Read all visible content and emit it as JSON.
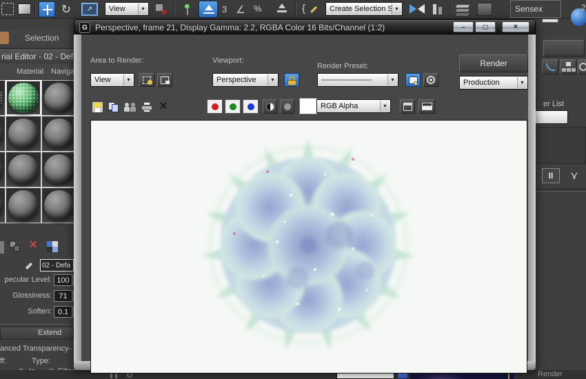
{
  "toolbar": {
    "ref_coord_value": "View",
    "snap3_label": "3",
    "percent_label": "%",
    "selection_set_value": "Create Selection Se",
    "tooltip_text": "Sensex",
    "tooltip_extra": "2"
  },
  "left": {
    "selection_tab": "Selection",
    "editor_title": "rial Editor - 02 - Def",
    "menu_material": "Material",
    "menu_navigation": "Navigat",
    "material_name": "02 - Defa",
    "params": [
      {
        "label": "pecular Level:",
        "value": "100"
      },
      {
        "label": "Glossiness:",
        "value": "71"
      },
      {
        "label": "Soften:",
        "value": "0.1"
      }
    ],
    "rollout_extended": "Extend",
    "group_transparency": "anced Transparency",
    "falloff_label": "ff:",
    "type_label": "Type:",
    "radio_in_label": "In",
    "radio_filter_label": "Filter :"
  },
  "rfw": {
    "title": "Perspective, frame 21, Display Gamma: 2.2, RGBA Color 16 Bits/Channel (1:2)",
    "area_label": "Area to Render:",
    "area_value": "View",
    "viewport_label": "Viewport:",
    "viewport_value": "Perspective",
    "preset_label": "Render Preset:",
    "preset_value": "--------------------",
    "render_button_label": "Render",
    "mode_value": "Production",
    "channel_value": "RGB Alpha"
  },
  "right": {
    "modifier_list_text": "er List",
    "pin_stack_glyph": "II"
  },
  "bottom": {
    "render_text": "Render"
  },
  "colors": {
    "accent_blue": "#3d82d8",
    "object_blue": "#b5cade",
    "object_green": "#c9e7d6",
    "render_bg": "#f5f8f5"
  },
  "icons": {
    "dropdown_arrow": "▼",
    "window_logo": "G",
    "minimize_glyph": "–",
    "maximize_glyph": "▢",
    "close_glyph": "×",
    "rotate_glyph": "↻",
    "scale_glyph": "↗",
    "angle_glyph": "∠",
    "brace_glyph": "{",
    "delete_glyph": "×",
    "me_delete_glyph": "×",
    "show_end_glyph": "⋎",
    "spin_up": "▲",
    "spin_down": "▼"
  }
}
